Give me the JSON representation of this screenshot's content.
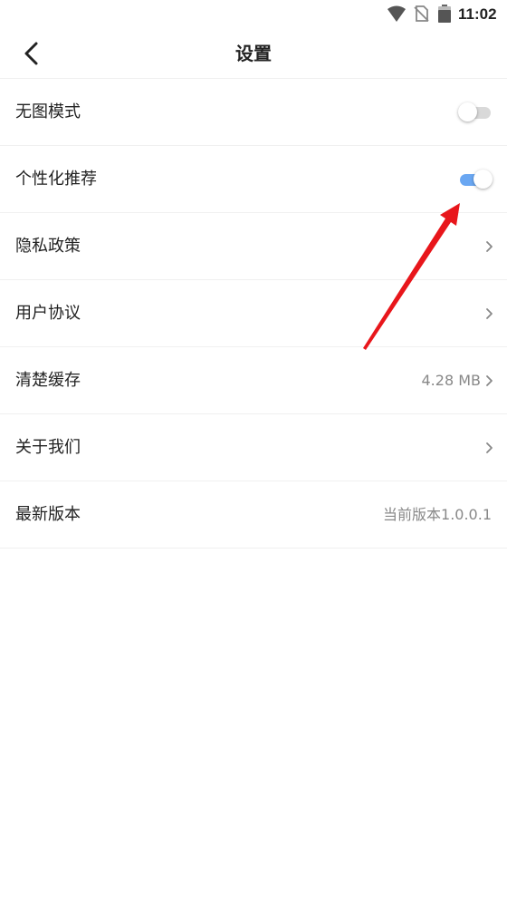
{
  "status_bar": {
    "time": "11:02",
    "icons": [
      "wifi-icon",
      "no-sim-icon",
      "battery-icon"
    ]
  },
  "header": {
    "title": "设置",
    "back_icon": "back-arrow-icon"
  },
  "settings": {
    "no_image_mode": {
      "label": "无图模式",
      "toggle": "off"
    },
    "personalized_recommendation": {
      "label": "个性化推荐",
      "toggle": "on"
    },
    "privacy_policy": {
      "label": "隐私政策"
    },
    "user_agreement": {
      "label": "用户协议"
    },
    "clear_cache": {
      "label": "清楚缓存",
      "value": "4.28 MB"
    },
    "about_us": {
      "label": "关于我们"
    },
    "latest_version": {
      "label": "最新版本",
      "value": "当前版本1.0.0.1"
    }
  },
  "colors": {
    "toggle_on": "#6aa7f2",
    "toggle_off": "#d9d9d9",
    "annotation_arrow": "#e8161b",
    "divider": "#f0f0f0",
    "secondary_text": "#888888"
  }
}
